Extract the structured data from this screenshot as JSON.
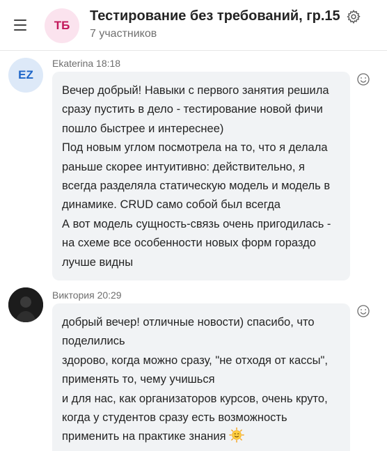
{
  "header": {
    "menu_icon": "hamburger-menu-icon",
    "avatar_initials": "ТБ",
    "title": "Тестирование без требований, гр.15",
    "settings_icon": "gear-icon",
    "subtitle": "7 участников"
  },
  "messages": [
    {
      "avatar_initials": "EZ",
      "author": "Ekaterina",
      "time": "18:18",
      "lines": [
        "Вечер добрый! Навыки с первого занятия решила сразу пустить в дело - тестирование новой фичи пошло быстрее и интереснее)",
        "Под новым углом посмотрела на то, что я делала раньше скорее интуитивно: действительно, я всегда разделяла статическую модель и модель в динамике. CRUD само собой был всегда",
        "А вот модель сущность-связь очень пригодилась - на схеме все особенности новых форм гораздо лучше видны"
      ],
      "reaction_icon": "smiley-reaction-icon"
    },
    {
      "avatar_kind": "photo",
      "author": "Виктория",
      "time": "20:29",
      "lines": [
        "добрый вечер! отличные новости) спасибо, что поделились",
        "здорово, когда можно сразу, \"не отходя от кассы\", применять то, чему учишься",
        "и для нас, как организаторов курсов, очень круто, когда у студентов сразу есть возможность применить на практике знания"
      ],
      "trailing_emoji": "sun-smile-emoji",
      "reaction_icon": "smiley-reaction-icon"
    }
  ],
  "colors": {
    "group_avatar_bg": "#fbe3ee",
    "group_avatar_text": "#c2185b",
    "user_avatar_bg": "#dde9f8",
    "user_avatar_text": "#1e66c8",
    "bubble_bg": "#f1f3f5"
  }
}
